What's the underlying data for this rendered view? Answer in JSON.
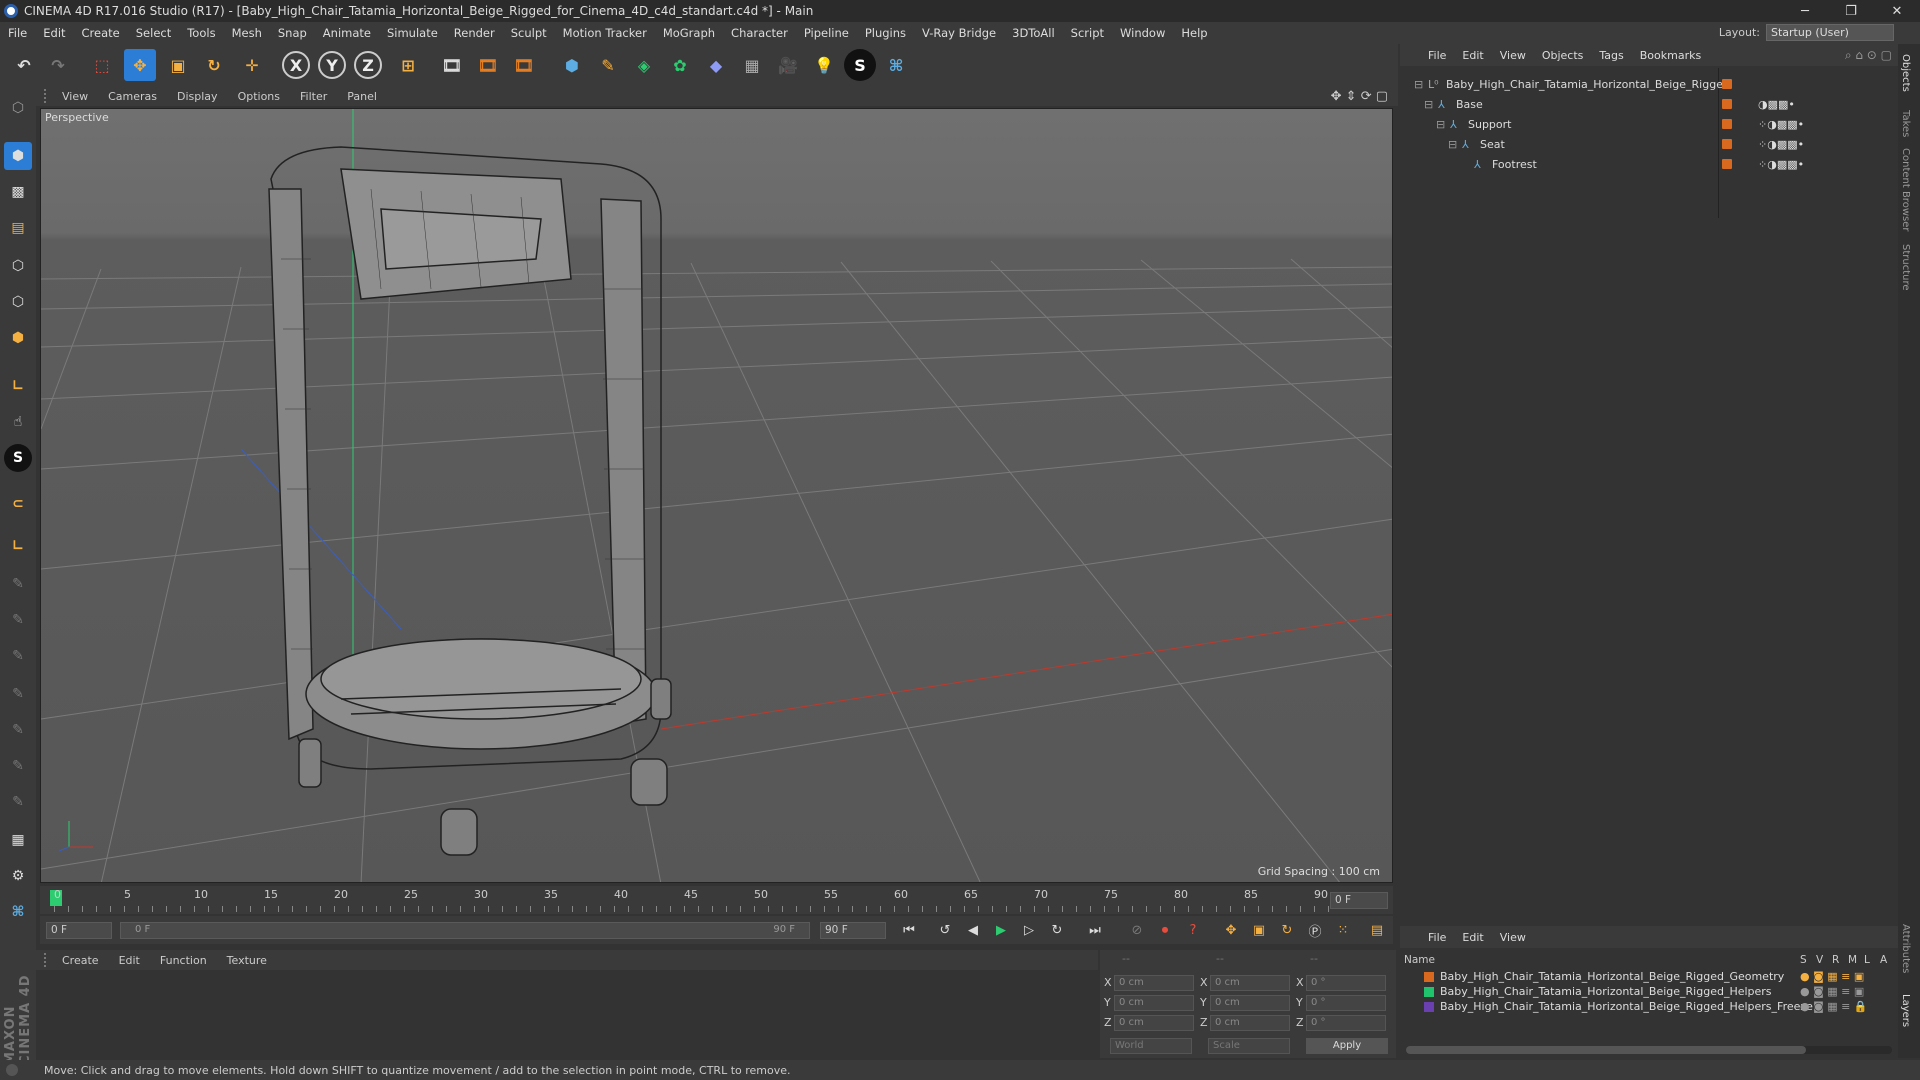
{
  "window": {
    "title": "CINEMA 4D R17.016 Studio (R17) - [Baby_High_Chair_Tatamia_Horizontal_Beige_Rigged_for_Cinema_4D_c4d_standart.c4d *] - Main",
    "minimize": "─",
    "restore": "❐",
    "close": "✕"
  },
  "menubar": {
    "items": [
      "File",
      "Edit",
      "Create",
      "Select",
      "Tools",
      "Mesh",
      "Snap",
      "Animate",
      "Simulate",
      "Render",
      "Sculpt",
      "Motion Tracker",
      "MoGraph",
      "Character",
      "Pipeline",
      "Plugins",
      "V-Ray Bridge",
      "3DToAll",
      "Script",
      "Window",
      "Help"
    ],
    "layout_label": "Layout:",
    "layout_value": "Startup (User)"
  },
  "toolbar": {
    "axis_x": "X",
    "axis_y": "Y",
    "axis_z": "Z"
  },
  "leftbar": {
    "maxon_text": "MAXON CINEMA 4D"
  },
  "viewport": {
    "menu": [
      "View",
      "Cameras",
      "Display",
      "Options",
      "Filter",
      "Panel"
    ],
    "label": "Perspective",
    "grid_spacing": "Grid Spacing : 100 cm"
  },
  "timeline": {
    "ticks": [
      "0",
      "5",
      "10",
      "15",
      "20",
      "25",
      "30",
      "35",
      "40",
      "45",
      "50",
      "55",
      "60",
      "65",
      "70",
      "75",
      "80",
      "85",
      "90"
    ],
    "current_frame": "0 F",
    "start_field": "0 F",
    "range_start": "0 F",
    "range_end": "90 F",
    "end_field": "90 F"
  },
  "material_manager": {
    "menu": [
      "Create",
      "Edit",
      "Function",
      "Texture"
    ]
  },
  "coordinates": {
    "header_dashes": [
      "--",
      "--",
      "--"
    ],
    "rows": [
      {
        "a": "X",
        "av": "0 cm",
        "b": "X",
        "bv": "0 cm",
        "c": "X",
        "cv": "0 °"
      },
      {
        "a": "Y",
        "av": "0 cm",
        "b": "Y",
        "bv": "0 cm",
        "c": "Y",
        "cv": "0 °"
      },
      {
        "a": "Z",
        "av": "0 cm",
        "b": "Z",
        "bv": "0 cm",
        "c": "Z",
        "cv": "0 °"
      }
    ],
    "world": "World",
    "scale": "Scale",
    "apply": "Apply"
  },
  "object_manager": {
    "menu": [
      "File",
      "Edit",
      "View",
      "Objects",
      "Tags",
      "Bookmarks"
    ],
    "objects": [
      {
        "name": "Baby_High_Chair_Tatamia_Horizontal_Beige_Rigged"
      },
      {
        "name": "Base"
      },
      {
        "name": "Support"
      },
      {
        "name": "Seat"
      },
      {
        "name": "Footrest"
      }
    ]
  },
  "layer_manager": {
    "menu": [
      "File",
      "Edit",
      "View"
    ],
    "columns": {
      "name": "Name",
      "s": "S",
      "v": "V",
      "r": "R",
      "m": "M",
      "l": "L",
      "a": "A"
    },
    "layers": [
      {
        "name": "Baby_High_Chair_Tatamia_Horizontal_Beige_Rigged_Geometry",
        "color": "#d9691f"
      },
      {
        "name": "Baby_High_Chair_Tatamia_Horizontal_Beige_Rigged_Helpers",
        "color": "#1fc46c"
      },
      {
        "name": "Baby_High_Chair_Tatamia_Horizontal_Beige_Rigged_Helpers_Freeze",
        "color": "#6a3fb0"
      }
    ]
  },
  "right_tabs": [
    "Objects",
    "Takes",
    "Content Browser",
    "Structure",
    "Attributes",
    "Layers"
  ],
  "status": "Move: Click and drag to move elements. Hold down SHIFT to quantize movement / add to the selection in point mode, CTRL to remove.",
  "colors": {
    "accent": "#2b7dd6",
    "object_dot": "#d9691f",
    "red_axis": "#c0392b",
    "green_axis": "#2ecc71"
  }
}
